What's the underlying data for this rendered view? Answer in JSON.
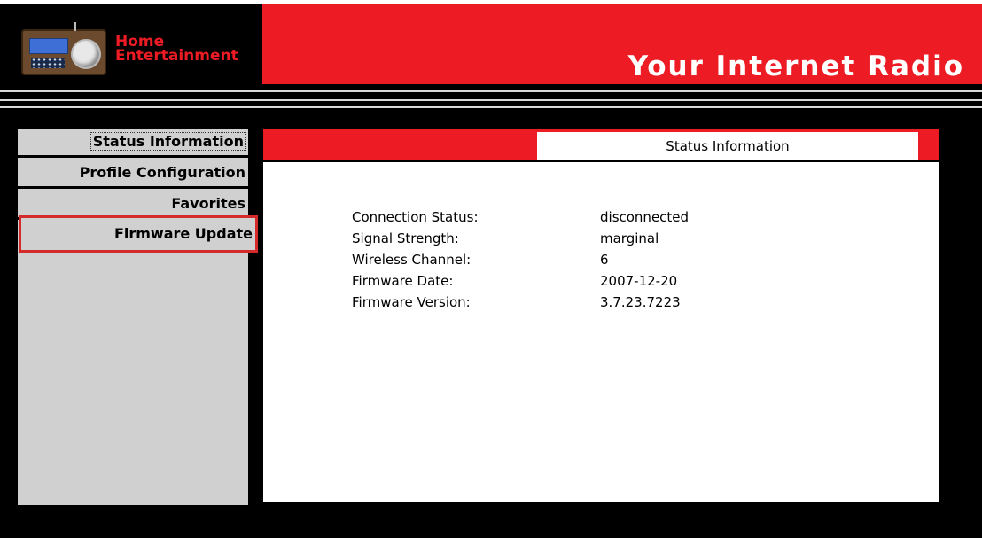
{
  "header": {
    "brand_line1": "Home",
    "brand_line2": "Entertainment",
    "title": "Your Internet Radio"
  },
  "sidebar": {
    "items": [
      {
        "label": "Status Information",
        "state": "selected"
      },
      {
        "label": "Profile Configuration"
      },
      {
        "label": "Favorites"
      },
      {
        "label": "Firmware Update",
        "state": "highlighted"
      }
    ]
  },
  "main": {
    "active_tab": "Status Information",
    "status": [
      {
        "key": "Connection Status:",
        "value": "disconnected"
      },
      {
        "key": "Signal Strength:",
        "value": "marginal"
      },
      {
        "key": "Wireless Channel:",
        "value": "6"
      },
      {
        "key": "Firmware Date:",
        "value": "2007-12-20"
      },
      {
        "key": "Firmware Version:",
        "value": "3.7.23.7223"
      }
    ]
  },
  "colors": {
    "accent_red": "#ed1c24",
    "sidebar_gray": "#d0d0d0",
    "highlight_border": "#d42a2a",
    "background": "#000000"
  },
  "icons": {
    "logo": "radio-icon"
  }
}
